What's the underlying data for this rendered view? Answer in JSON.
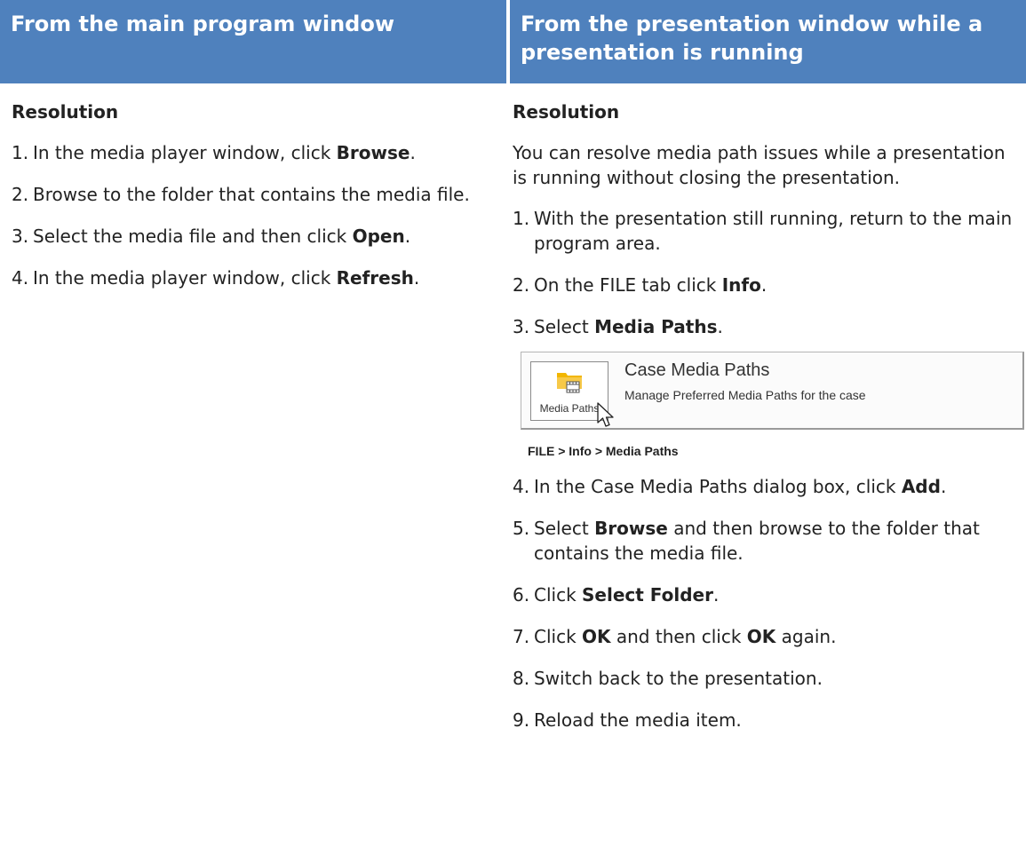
{
  "headers": {
    "left": "From the main program window",
    "right": "From the presentation window while a presentation is running"
  },
  "left": {
    "heading": "Resolution",
    "steps": [
      {
        "num": "1.",
        "pre": "In the media player window, click ",
        "bold": "Browse",
        "post": "."
      },
      {
        "num": "2.",
        "pre": "Browse to the folder that contains the media file.",
        "bold": "",
        "post": ""
      },
      {
        "num": "3.",
        "pre": "Select the media file and then click ",
        "bold": "Open",
        "post": "."
      },
      {
        "num": "4.",
        "pre": "In the media player window, click ",
        "bold": "Refresh",
        "post": "."
      }
    ]
  },
  "right": {
    "heading": "Resolution",
    "intro": "You can resolve media path issues while a presentation is running without closing the presentation.",
    "steps_a": [
      {
        "num": "1.",
        "pre": "With the presentation still running, return to the main program area.",
        "bold": "",
        "post": ""
      },
      {
        "num": "2.",
        "pre": "On the FILE tab click ",
        "bold": "Info",
        "post": "."
      },
      {
        "num": "3.",
        "pre": "Select ",
        "bold": "Media Paths",
        "post": "."
      }
    ],
    "screenshot": {
      "button_label": "Media Paths",
      "title": "Case Media Paths",
      "description": "Manage Preferred Media Paths for the case",
      "folder_color": "#f2b600"
    },
    "caption": "FILE > Info > Media Paths",
    "steps_b": [
      {
        "num": "4.",
        "pre": "In the Case Media Paths dialog box, click ",
        "bold": "Add",
        "post": "."
      },
      {
        "num": "5.",
        "pre": "Select ",
        "bold": "Browse",
        "post": " and then browse to the folder that contains the media file."
      },
      {
        "num": "6.",
        "pre": "Click ",
        "bold": "Select Folder",
        "post": "."
      },
      {
        "num": "7.",
        "pre": "Click ",
        "bold": "OK",
        "post": " and then click "
      },
      {
        "num": "8.",
        "pre": "Switch back to the presentation.",
        "bold": "",
        "post": ""
      },
      {
        "num": "9.",
        "pre": "Reload the media item.",
        "bold": "",
        "post": ""
      }
    ],
    "step7_bold2": "OK",
    "step7_tail": " again."
  },
  "colors": {
    "header_bg": "#4f81bd",
    "header_text": "#ffffff"
  }
}
